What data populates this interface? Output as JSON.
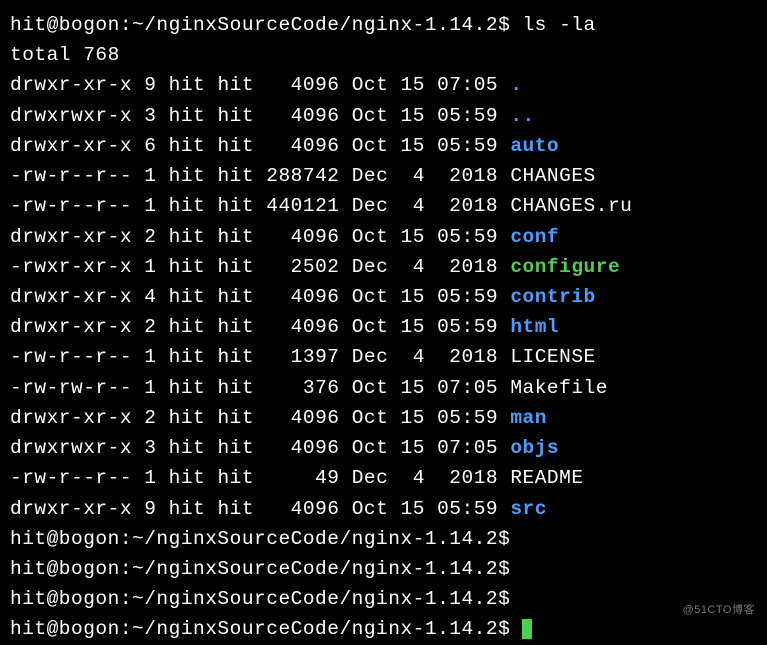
{
  "prompt": {
    "user": "hit",
    "host": "bogon",
    "path": "~/nginxSourceCode/nginx-1.14.2",
    "suffix": "$"
  },
  "command": "ls -la",
  "total_line": "total 768",
  "entries": [
    {
      "perms": "drwxr-xr-x",
      "links": "9",
      "owner": "hit",
      "group": "hit",
      "size": "  4096",
      "date": "Oct 15 07:05",
      "name": ".",
      "type": "dir"
    },
    {
      "perms": "drwxrwxr-x",
      "links": "3",
      "owner": "hit",
      "group": "hit",
      "size": "  4096",
      "date": "Oct 15 05:59",
      "name": "..",
      "type": "dir"
    },
    {
      "perms": "drwxr-xr-x",
      "links": "6",
      "owner": "hit",
      "group": "hit",
      "size": "  4096",
      "date": "Oct 15 05:59",
      "name": "auto",
      "type": "dir"
    },
    {
      "perms": "-rw-r--r--",
      "links": "1",
      "owner": "hit",
      "group": "hit",
      "size": "288742",
      "date": "Dec  4  2018",
      "name": "CHANGES",
      "type": "file"
    },
    {
      "perms": "-rw-r--r--",
      "links": "1",
      "owner": "hit",
      "group": "hit",
      "size": "440121",
      "date": "Dec  4  2018",
      "name": "CHANGES.ru",
      "type": "file"
    },
    {
      "perms": "drwxr-xr-x",
      "links": "2",
      "owner": "hit",
      "group": "hit",
      "size": "  4096",
      "date": "Oct 15 05:59",
      "name": "conf",
      "type": "dir"
    },
    {
      "perms": "-rwxr-xr-x",
      "links": "1",
      "owner": "hit",
      "group": "hit",
      "size": "  2502",
      "date": "Dec  4  2018",
      "name": "configure",
      "type": "exec"
    },
    {
      "perms": "drwxr-xr-x",
      "links": "4",
      "owner": "hit",
      "group": "hit",
      "size": "  4096",
      "date": "Oct 15 05:59",
      "name": "contrib",
      "type": "dir"
    },
    {
      "perms": "drwxr-xr-x",
      "links": "2",
      "owner": "hit",
      "group": "hit",
      "size": "  4096",
      "date": "Oct 15 05:59",
      "name": "html",
      "type": "dir"
    },
    {
      "perms": "-rw-r--r--",
      "links": "1",
      "owner": "hit",
      "group": "hit",
      "size": "  1397",
      "date": "Dec  4  2018",
      "name": "LICENSE",
      "type": "file"
    },
    {
      "perms": "-rw-rw-r--",
      "links": "1",
      "owner": "hit",
      "group": "hit",
      "size": "   376",
      "date": "Oct 15 07:05",
      "name": "Makefile",
      "type": "file"
    },
    {
      "perms": "drwxr-xr-x",
      "links": "2",
      "owner": "hit",
      "group": "hit",
      "size": "  4096",
      "date": "Oct 15 05:59",
      "name": "man",
      "type": "dir"
    },
    {
      "perms": "drwxrwxr-x",
      "links": "3",
      "owner": "hit",
      "group": "hit",
      "size": "  4096",
      "date": "Oct 15 07:05",
      "name": "objs",
      "type": "dir"
    },
    {
      "perms": "-rw-r--r--",
      "links": "1",
      "owner": "hit",
      "group": "hit",
      "size": "    49",
      "date": "Dec  4  2018",
      "name": "README",
      "type": "file"
    },
    {
      "perms": "drwxr-xr-x",
      "links": "9",
      "owner": "hit",
      "group": "hit",
      "size": "  4096",
      "date": "Oct 15 05:59",
      "name": "src",
      "type": "dir"
    }
  ],
  "empty_prompts": 3,
  "watermark": "@51CTO博客"
}
